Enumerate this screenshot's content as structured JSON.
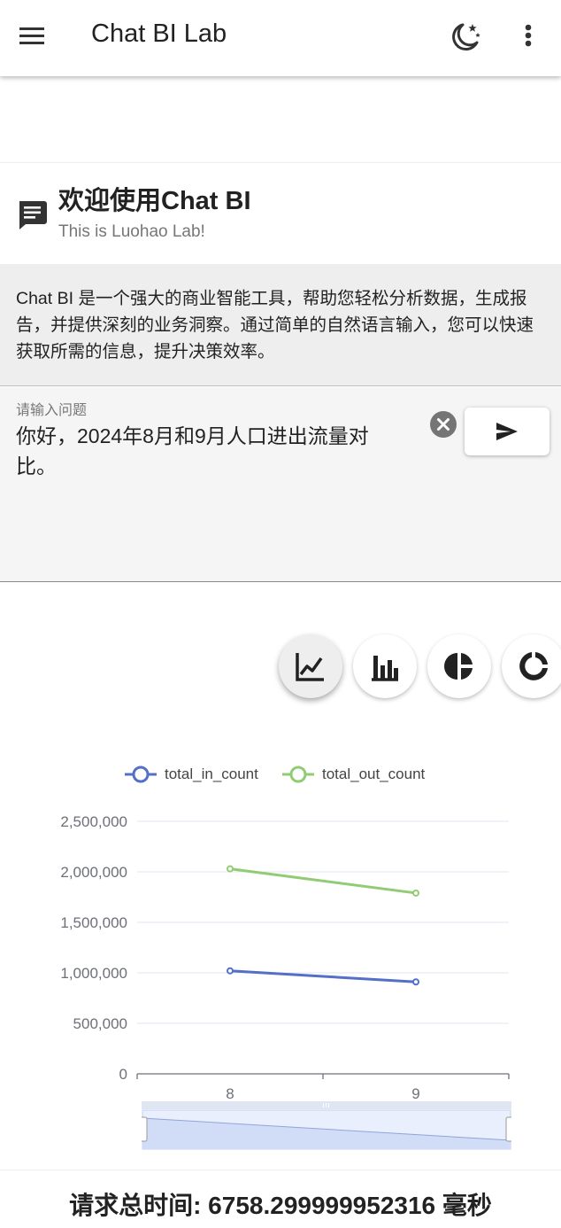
{
  "app": {
    "title": "Chat BI Lab"
  },
  "icons": {
    "menu": "menu-icon",
    "theme": "moon-stars-icon",
    "more": "more-vert-icon",
    "welcome": "chat-icon",
    "clear": "clear-icon",
    "send": "send-icon",
    "line": "line-chart-icon",
    "bar": "bar-chart-icon",
    "pie": "pie-chart-icon",
    "ring": "ring-chart-icon"
  },
  "welcome": {
    "title": "欢迎使用Chat BI",
    "subtitle": "This is Luohao Lab!"
  },
  "description": "Chat BI 是一个强大的商业智能工具，帮助您轻松分析数据，生成报告，并提供深刻的业务洞察。通过简单的自然语言输入，您可以快速获取所需的信息，提升决策效率。",
  "input": {
    "label": "请输入问题",
    "value": "你好，2024年8月和9月人口进出流量对比。"
  },
  "chart_types": [
    "line",
    "bar",
    "pie",
    "ring"
  ],
  "active_chart_type": "line",
  "chart_data": {
    "type": "line",
    "x": [
      "8",
      "9"
    ],
    "series": [
      {
        "name": "total_in_count",
        "values": [
          1020000,
          910000
        ],
        "color": "#5470c6"
      },
      {
        "name": "total_out_count",
        "values": [
          2030000,
          1790000
        ],
        "color": "#91cc75"
      }
    ],
    "ylim": [
      0,
      2500000
    ],
    "yticks": [
      0,
      500000,
      1000000,
      1500000,
      2000000,
      2500000
    ],
    "ytick_labels": [
      "0",
      "500,000",
      "1,000,000",
      "1,500,000",
      "2,000,000",
      "2,500,000"
    ],
    "legend": "top-center",
    "grid": true,
    "data_zoom": [
      0,
      100
    ]
  },
  "footer": {
    "total_time": "请求总时间: 6758.299999952316 毫秒"
  }
}
